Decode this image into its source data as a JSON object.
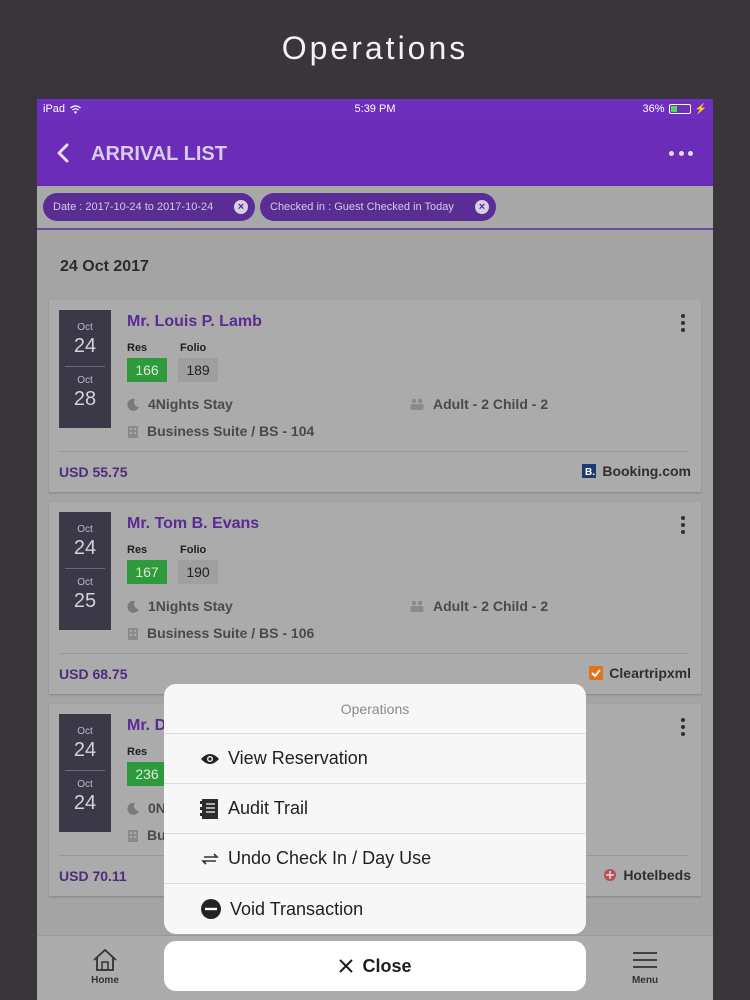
{
  "hero_title": "Operations",
  "statusbar": {
    "device": "iPad",
    "time": "5:39 PM",
    "battery": "36%",
    "battery_level": 0.36
  },
  "appbar": {
    "title": "ARRIVAL LIST"
  },
  "filters": [
    {
      "label": "Date : 2017-10-24 to 2017-10-24"
    },
    {
      "label": "Checked in : Guest Checked in Today"
    }
  ],
  "list": {
    "date_header": "24 Oct 2017",
    "labels": {
      "res": "Res",
      "folio": "Folio"
    },
    "cards": [
      {
        "in_month": "Oct",
        "in_day": "24",
        "out_month": "Oct",
        "out_day": "28",
        "guest": "Mr. Louis P. Lamb",
        "res": "166",
        "folio": "189",
        "stay": "4Nights Stay",
        "pax": "Adult - 2 Child - 2",
        "room": "Business Suite / BS - 104",
        "price": "USD 55.75",
        "source": "Booking.com"
      },
      {
        "in_month": "Oct",
        "in_day": "24",
        "out_month": "Oct",
        "out_day": "25",
        "guest": "Mr. Tom B. Evans",
        "res": "167",
        "folio": "190",
        "stay": "1Nights Stay",
        "pax": "Adult - 2 Child - 2",
        "room": "Business Suite / BS - 106",
        "price": "USD 68.75",
        "source": "Cleartripxml"
      },
      {
        "in_month": "Oct",
        "in_day": "24",
        "out_month": "Oct",
        "out_day": "24",
        "guest": "Mr. D",
        "res": "236",
        "stay": "0N",
        "room": "Bu",
        "price": "USD 70.11",
        "source": "Hotelbeds"
      }
    ]
  },
  "tabbar": {
    "home": "Home",
    "menu": "Menu"
  },
  "sheet": {
    "title": "Operations",
    "items": [
      {
        "label": "View Reservation",
        "icon": "eye-icon"
      },
      {
        "label": "Audit Trail",
        "icon": "document-icon"
      },
      {
        "label": "Undo Check In / Day Use",
        "icon": "swap-icon"
      },
      {
        "label": "Void Transaction",
        "icon": "minus-circle-icon"
      }
    ],
    "close_label": "Close"
  }
}
